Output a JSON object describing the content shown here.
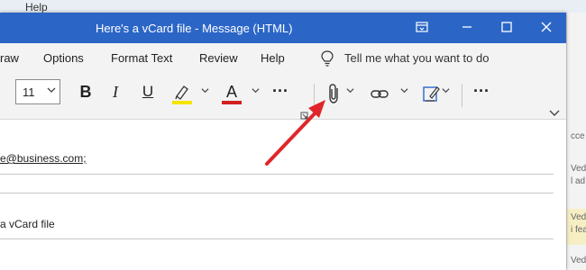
{
  "background": {
    "menu_label": "Help",
    "right_labels": [
      "cce",
      "Ved",
      "l ad",
      "Ved",
      "i fea",
      "Ved"
    ]
  },
  "window": {
    "title": "Here's a vCard file  -  Message (HTML)",
    "controls": [
      "restore-ribbon-icon",
      "minimize-icon",
      "maximize-icon",
      "close-icon"
    ]
  },
  "menu": {
    "items": [
      "raw",
      "Options",
      "Format Text",
      "Review",
      "Help"
    ],
    "tell_me": "Tell me what you want to do"
  },
  "ribbon": {
    "font_size": "11",
    "bold": "B",
    "italic": "I",
    "underline": "U",
    "font_color_letter": "A",
    "more": "···",
    "highlight_color": "#f5e400",
    "font_color": "#d21f1f"
  },
  "message": {
    "to": "e@business.com;",
    "subject": "a vCard file"
  },
  "colors": {
    "title_bar": "#2b66c7",
    "arrow": "#e0262a"
  }
}
